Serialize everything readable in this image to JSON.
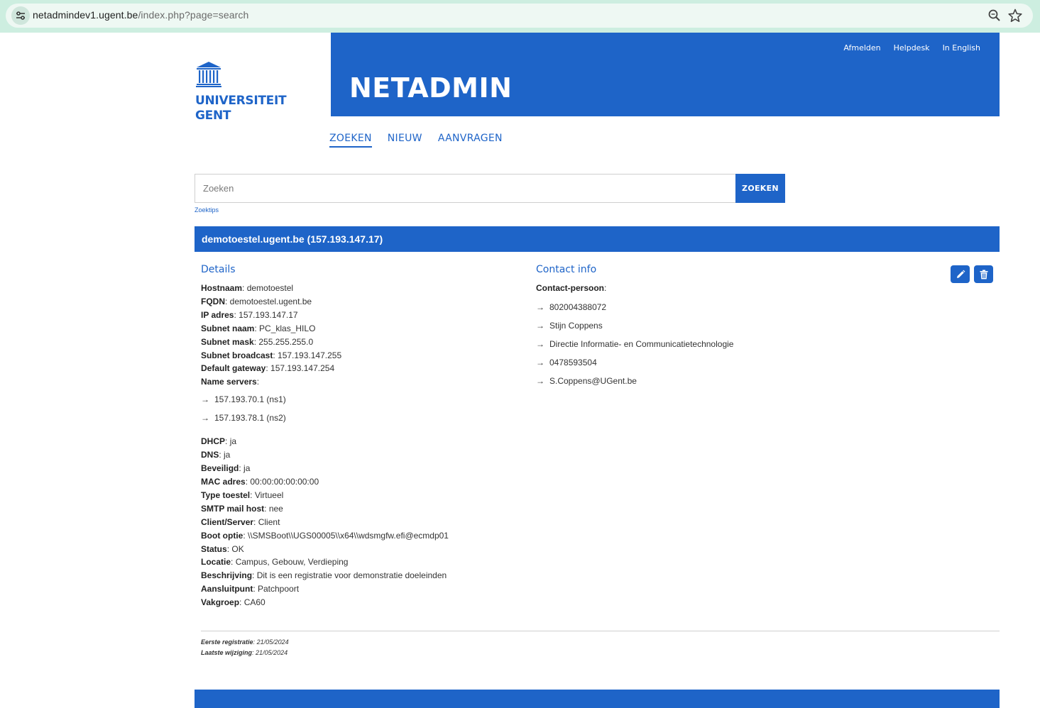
{
  "browser": {
    "url_host": "netadmindev1.ugent.be",
    "url_path": "/index.php?page=search",
    "site_info_icon": "tune-icon",
    "zoom_icon": "zoom-icon",
    "bookmark_icon": "star-icon"
  },
  "brand": {
    "line1": "UNIVERSITEIT",
    "line2": "GENT",
    "app_title": "NETADMIN",
    "color": "#1e64c8"
  },
  "top_links": {
    "logout": "Afmelden",
    "helpdesk": "Helpdesk",
    "english": "In English"
  },
  "nav": {
    "search": "ZOEKEN",
    "new": "NIEUW",
    "requests": "AANVRAGEN",
    "active": "ZOEKEN"
  },
  "search": {
    "placeholder": "Zoeken",
    "value": "",
    "button": "ZOEKEN",
    "tips": "Zoektips"
  },
  "result": {
    "title": "demotoestel.ugent.be (157.193.147.17)",
    "details_title": "Details",
    "details": [
      {
        "label": "Hostnaam",
        "value": "demotoestel"
      },
      {
        "label": "FQDN",
        "value": "demotoestel.ugent.be"
      },
      {
        "label": "IP adres",
        "value": "157.193.147.17"
      },
      {
        "label": "Subnet naam",
        "value": "PC_klas_HILO"
      },
      {
        "label": "Subnet mask",
        "value": "255.255.255.0"
      },
      {
        "label": "Subnet broadcast",
        "value": "157.193.147.255"
      },
      {
        "label": "Default gateway",
        "value": "157.193.147.254"
      }
    ],
    "name_servers_label": "Name servers",
    "name_servers": [
      "157.193.70.1 (ns1)",
      "157.193.78.1 (ns2)"
    ],
    "details2": [
      {
        "label": "DHCP",
        "value": "ja"
      },
      {
        "label": "DNS",
        "value": "ja"
      },
      {
        "label": "Beveiligd",
        "value": "ja"
      },
      {
        "label": "MAC adres",
        "value": "00:00:00:00:00:00"
      },
      {
        "label": "Type toestel",
        "value": "Virtueel"
      },
      {
        "label": "SMTP mail host",
        "value": "nee"
      },
      {
        "label": "Client/Server",
        "value": "Client"
      },
      {
        "label": "Boot optie",
        "value": "\\\\SMSBoot\\\\UGS00005\\\\x64\\\\wdsmgfw.efi@ecmdp01"
      },
      {
        "label": "Status",
        "value": "OK"
      },
      {
        "label": "Locatie",
        "value": "Campus, Gebouw, Verdieping"
      },
      {
        "label": "Beschrijving",
        "value": "Dit is een registratie voor demonstratie doeleinden"
      },
      {
        "label": "Aansluitpunt",
        "value": "Patchpoort"
      },
      {
        "label": "Vakgroep",
        "value": "CA60"
      }
    ],
    "contact_title": "Contact info",
    "contact_label": "Contact-persoon",
    "contact": [
      "802004388072",
      "Stijn Coppens",
      "Directie Informatie- en Communicatietechnologie",
      "0478593504",
      "S.Coppens@UGent.be"
    ],
    "edit_icon": "pencil-icon",
    "delete_icon": "trash-icon",
    "first_registration_label": "Eerste registratie",
    "first_registration": "21/05/2024",
    "last_change_label": "Laatste wijziging",
    "last_change": "21/05/2024"
  }
}
